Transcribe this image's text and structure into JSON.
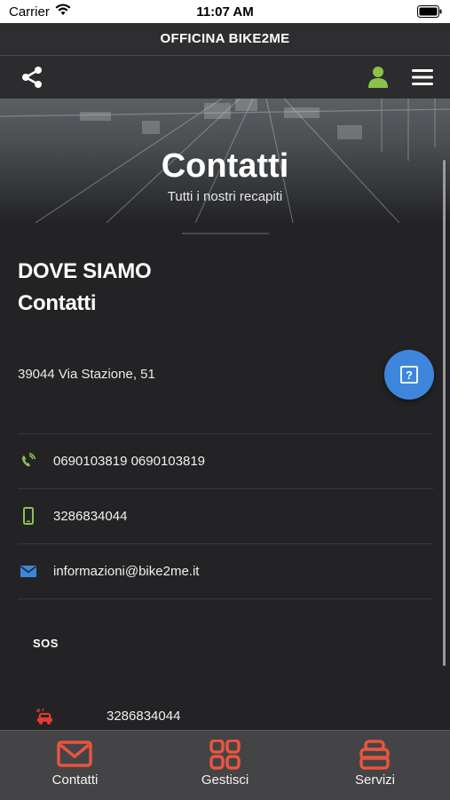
{
  "status": {
    "carrier": "Carrier",
    "time": "11:07 AM"
  },
  "app": {
    "title": "OFFICINA BIKE2ME"
  },
  "toolbar": {
    "share_icon": "share-icon",
    "user_icon": "user-icon",
    "menu_icon": "hamburger-menu-icon",
    "user_color": "#8bc34a"
  },
  "hero": {
    "title": "Contatti",
    "subtitle": "Tutti i nostri recapiti"
  },
  "section": {
    "heading1": "DOVE SIAMO",
    "heading2": "Contatti",
    "address": "39044 Via Stazione, 51"
  },
  "contacts": [
    {
      "icon": "phone-icon",
      "text": "0690103819 0690103819",
      "color": "#8bc34a"
    },
    {
      "icon": "mobile-icon",
      "text": "3286834044",
      "color": "#8bc34a"
    },
    {
      "icon": "envelope-icon",
      "text": "informazioni@bike2me.it",
      "color": "#3d86db"
    }
  ],
  "sos": {
    "label": "SOS",
    "number": "3286834044",
    "icon": "car-crash-icon",
    "color": "#e53935"
  },
  "help_button": {
    "icon": "help-icon",
    "color": "#3d86db"
  },
  "tabs": [
    {
      "label": "Contatti",
      "icon": "envelope-icon"
    },
    {
      "label": "Gestisci",
      "icon": "grid-icon"
    },
    {
      "label": "Servizi",
      "icon": "layers-icon"
    }
  ],
  "accent_color": "#e8553f"
}
